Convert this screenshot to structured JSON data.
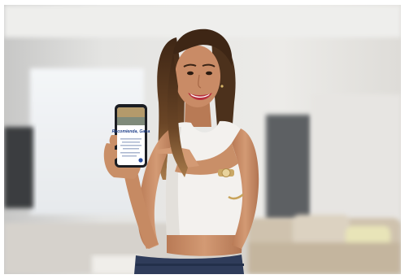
{
  "scene": {
    "subject": "woman-holding-smartphone",
    "setting": "blurred-living-room",
    "colors": {
      "wall": "#e9e7e4",
      "window": "#f7f8f9",
      "sofa": "#d9cdbb",
      "skin": "#c98b66",
      "hair": "#5a3b22",
      "top": "#f3f1ee",
      "jeans": "#2f3c5a",
      "phone_body": "#1b1d22",
      "phone_brand": "#1f3f8a"
    }
  },
  "phone_screen": {
    "heading": "Recomienda, Gana",
    "body_lines": 6
  }
}
